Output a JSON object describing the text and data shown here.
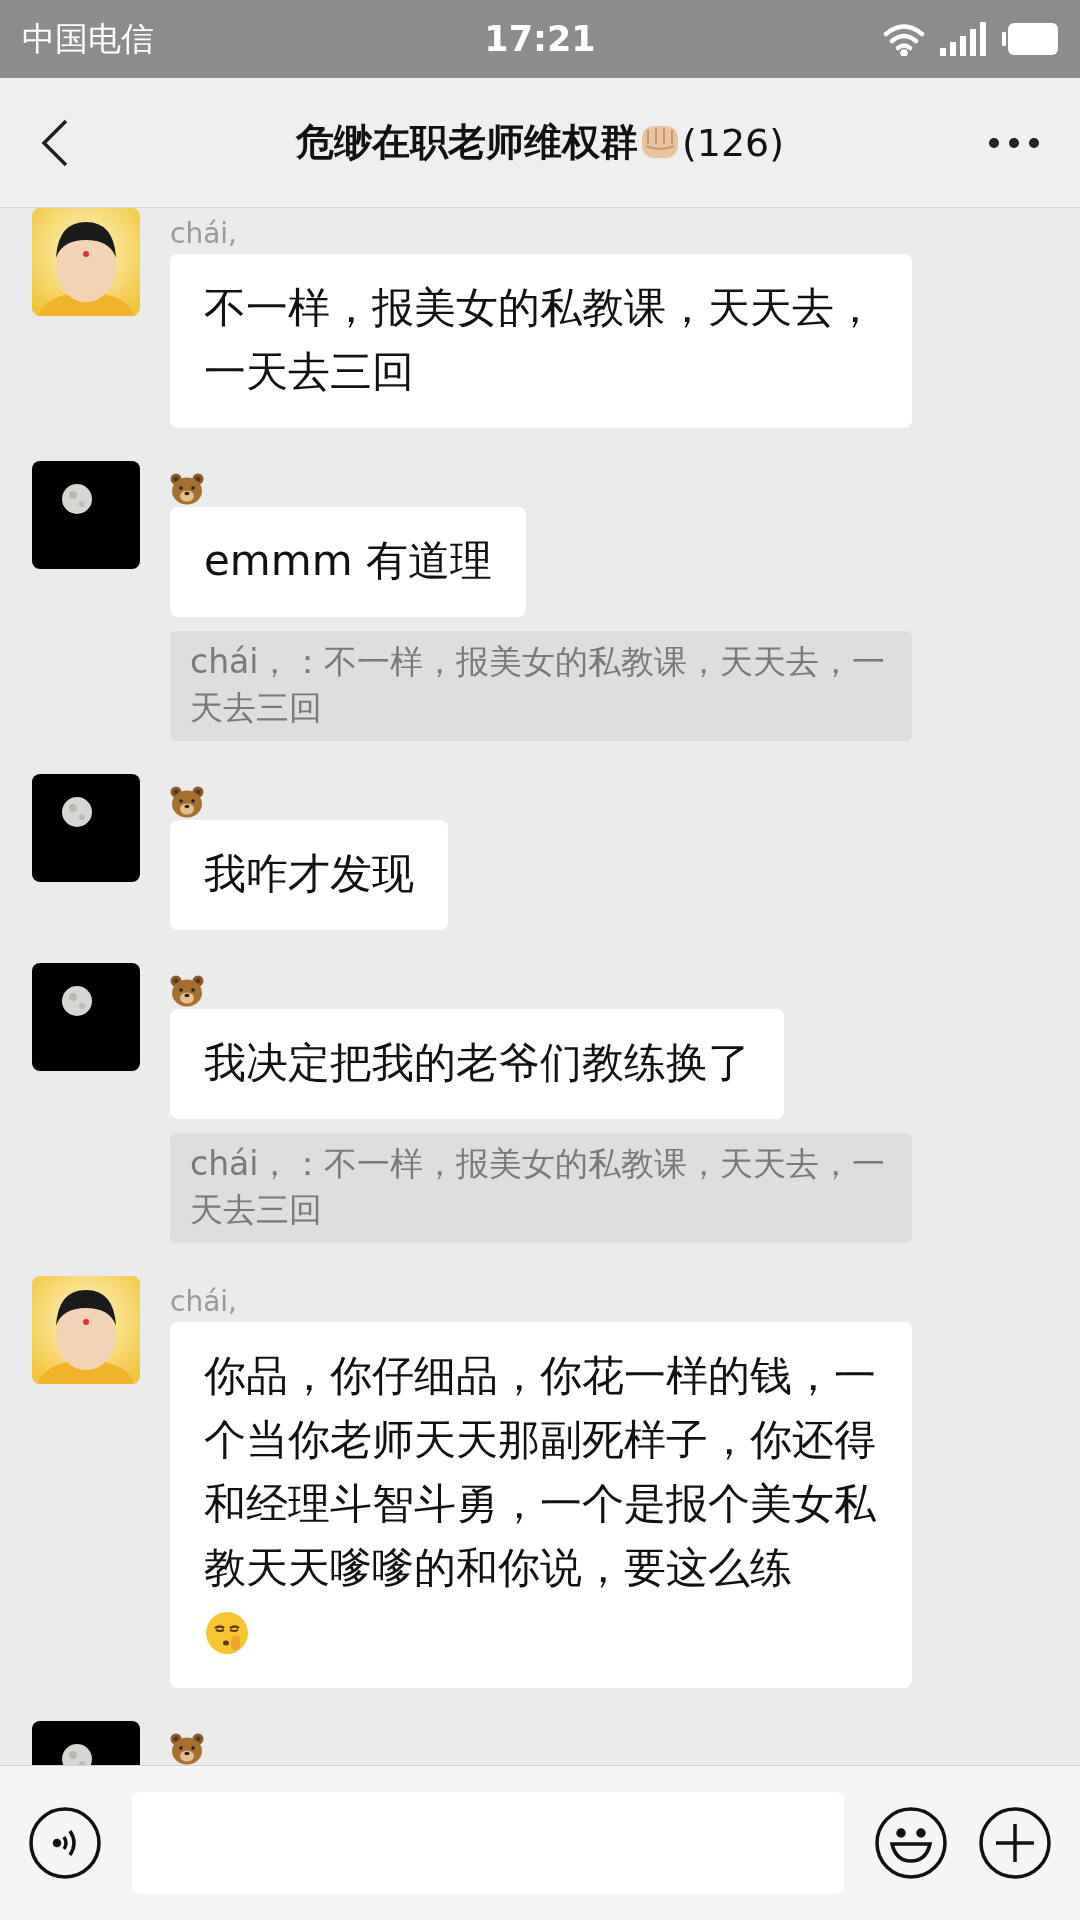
{
  "status_bar": {
    "carrier": "中国电信",
    "time": "17:21"
  },
  "nav_bar": {
    "title": "危缈在职老师维权群",
    "title_emoji": true,
    "member_count": "(126)"
  },
  "messages": [
    {
      "kind": "person",
      "name": "chái,",
      "text": "不一样，报美女的私教课，天天去，一天去三回"
    },
    {
      "kind": "moon",
      "text": "emmm 有道理",
      "quote": "chái，：不一样，报美女的私教课，天天去，一天去三回"
    },
    {
      "kind": "moon",
      "text": "我咋才发现"
    },
    {
      "kind": "moon",
      "text": "我决定把我的老爷们教练换了",
      "quote": "chái，：不一样，报美女的私教课，天天去，一天去三回"
    },
    {
      "kind": "person",
      "name": "chái,",
      "text": "你品，你仔细品，你花一样的钱，一个当你老师天天那副死样子，你还得和经理斗智斗勇，一个是报个美女私教天天嗲嗲的和你说，要这么练",
      "trailing_emoji": true
    },
    {
      "kind": "moon"
    }
  ]
}
